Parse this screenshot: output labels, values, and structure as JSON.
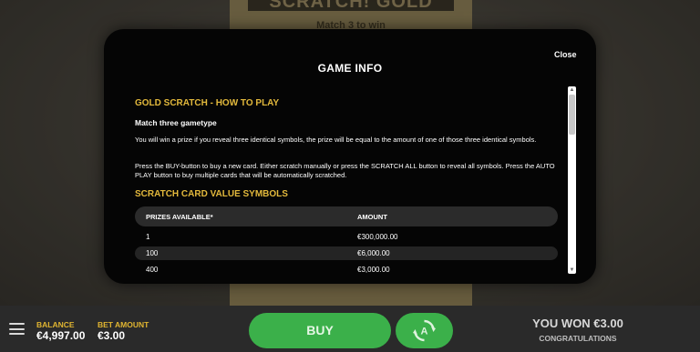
{
  "background_card": {
    "logo": "SCRATCH! GOLD",
    "subtitle": "Match 3 to win"
  },
  "modal": {
    "title": "GAME INFO",
    "close_label": "Close",
    "heading_how_to_play": "GOLD SCRATCH - HOW TO PLAY",
    "gametype": "Match three gametype",
    "paragraph_1": "You will win a prize if you reveal three identical symbols, the prize will be equal to the amount of one of those three identical symbols.",
    "paragraph_2": "Press the BUY-button to buy a new card. Either scratch manually or press the SCRATCH ALL button to reveal all symbols. Press the AUTO PLAY button to buy multiple cards that will be automatically scratched.",
    "heading_values": "SCRATCH CARD VALUE SYMBOLS",
    "table": {
      "headers": [
        "PRIZES AVAILABLE*",
        "AMOUNT"
      ],
      "rows": [
        [
          "1",
          "€300,000.00"
        ],
        [
          "100",
          "€6,000.00"
        ],
        [
          "400",
          "€3,000.00"
        ]
      ]
    }
  },
  "bottom_bar": {
    "menu_icon": "hamburger-menu-icon",
    "balance_label": "BALANCE",
    "balance_value": "€4,997.00",
    "bet_label": "BET AMOUNT",
    "bet_value": "€3.00",
    "buy_label": "BUY",
    "autoplay_icon": "autoplay-icon",
    "won_text": "YOU WON €3.00",
    "congrats_text": "CONGRATULATIONS"
  },
  "colors": {
    "accent_gold": "#e3b93c",
    "button_green": "#3bb04a",
    "modal_bg": "#050505"
  }
}
